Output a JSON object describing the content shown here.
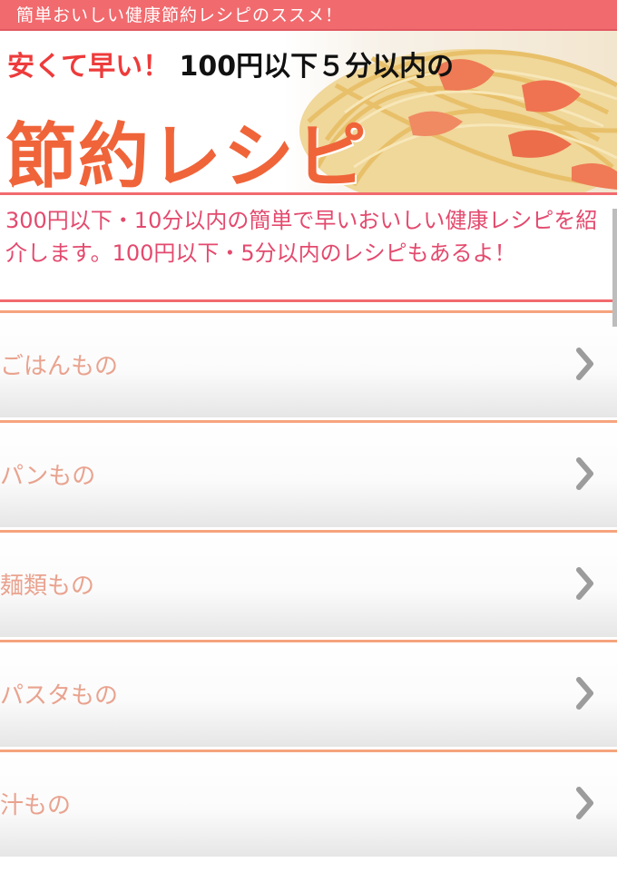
{
  "header": {
    "title": "簡単おいしい健康節約レシピのススメ！"
  },
  "hero": {
    "subtitle_accent": "安くて早い！",
    "subtitle_rest": " 100円以下５分以内の",
    "title": "節約レシピ"
  },
  "intro": {
    "text": "300円以下・10分以内の簡単で早いおいしい健康レシピを紹介します。100円以下・5分以内のレシピもあるよ！"
  },
  "menu": {
    "items": [
      {
        "label": "ごはんもの"
      },
      {
        "label": "パンもの"
      },
      {
        "label": "麺類もの"
      },
      {
        "label": "パスタもの"
      },
      {
        "label": "汁もの"
      }
    ]
  },
  "colors": {
    "header_bg": "#f16a6e",
    "intro_text": "#e34a6e",
    "menu_label": "#e9a38f",
    "menu_border": "#f6a47e",
    "hero_title": "#f0643a"
  },
  "icons": {
    "chevron": "chevron-right-icon"
  }
}
